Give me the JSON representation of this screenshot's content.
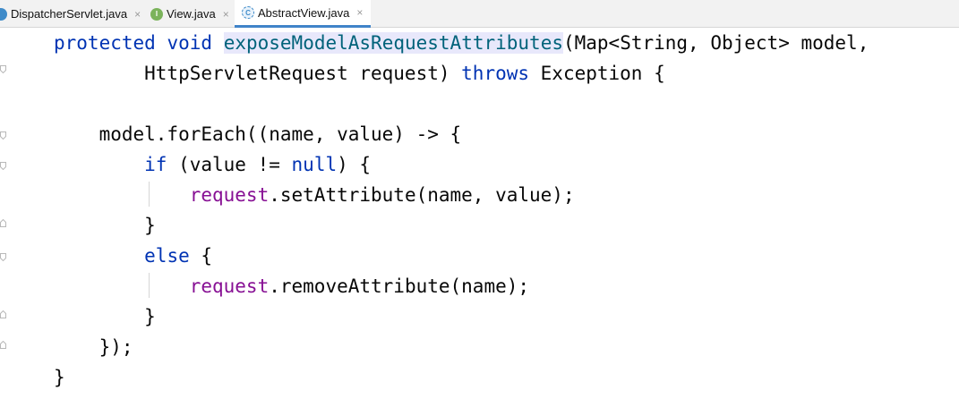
{
  "tabs": [
    {
      "label": "DispatcherServlet.java",
      "close": "×",
      "icon": "class-icon",
      "active": false
    },
    {
      "label": "View.java",
      "close": "×",
      "icon": "interface-icon",
      "icon_letter": "I",
      "active": false
    },
    {
      "label": "AbstractView.java",
      "close": "×",
      "icon": "abstract-class-icon",
      "icon_letter": "C",
      "active": true
    }
  ],
  "editor": {
    "colors": {
      "keyword": "#0033b3",
      "method_decl": "#00627a",
      "method_decl_bg": "#e8e8fb",
      "field": "#871094",
      "plain": "#080808"
    },
    "lines": [
      [
        {
          "t": "protected",
          "c": "kw"
        },
        {
          "t": " "
        },
        {
          "t": "void",
          "c": "kw"
        },
        {
          "t": " "
        },
        {
          "t": "exposeModelAsRequestAttributes",
          "c": "fn"
        },
        {
          "t": "(Map<String, Object> model,"
        }
      ],
      [
        {
          "t": "        HttpServletRequest request) "
        },
        {
          "t": "throws",
          "c": "kw"
        },
        {
          "t": " Exception {"
        }
      ],
      [
        {
          "t": ""
        }
      ],
      [
        {
          "t": "    model.forEach((name, value) -> {"
        }
      ],
      [
        {
          "t": "        "
        },
        {
          "t": "if",
          "c": "kw"
        },
        {
          "t": " (value != "
        },
        {
          "t": "null",
          "c": "kw"
        },
        {
          "t": ") {"
        }
      ],
      [
        {
          "t": "            "
        },
        {
          "t": "request",
          "c": "fld"
        },
        {
          "t": ".setAttribute(name, value);"
        }
      ],
      [
        {
          "t": "        }"
        }
      ],
      [
        {
          "t": "        "
        },
        {
          "t": "else",
          "c": "kw"
        },
        {
          "t": " {"
        }
      ],
      [
        {
          "t": "            "
        },
        {
          "t": "request",
          "c": "fld"
        },
        {
          "t": ".removeAttribute(name);"
        }
      ],
      [
        {
          "t": "        }"
        }
      ],
      [
        {
          "t": "    });"
        }
      ],
      [
        {
          "t": "}"
        }
      ]
    ]
  }
}
